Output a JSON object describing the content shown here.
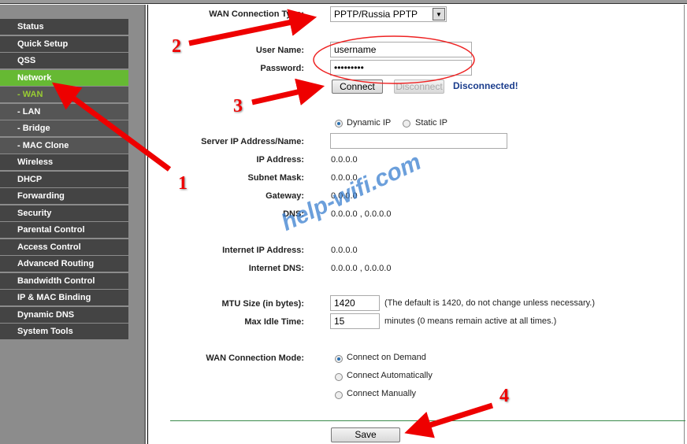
{
  "sidebar": {
    "items": [
      {
        "label": "Status"
      },
      {
        "label": "Quick Setup"
      },
      {
        "label": "QSS"
      },
      {
        "label": "Network",
        "active": true
      },
      {
        "label": "- WAN",
        "sub": true,
        "current": true
      },
      {
        "label": "- LAN",
        "sub": true
      },
      {
        "label": "- Bridge",
        "sub": true
      },
      {
        "label": "- MAC Clone",
        "sub": true
      },
      {
        "label": "Wireless"
      },
      {
        "label": "DHCP"
      },
      {
        "label": "Forwarding"
      },
      {
        "label": "Security"
      },
      {
        "label": "Parental Control"
      },
      {
        "label": "Access Control"
      },
      {
        "label": "Advanced Routing"
      },
      {
        "label": "Bandwidth Control"
      },
      {
        "label": "IP & MAC Binding"
      },
      {
        "label": "Dynamic DNS"
      },
      {
        "label": "System Tools"
      }
    ]
  },
  "form": {
    "wan_type_label": "WAN Connection Type:",
    "wan_type_value": "PPTP/Russia PPTP",
    "username_label": "User Name:",
    "username_value": "username",
    "password_label": "Password:",
    "password_value": "•••••••••",
    "connect": "Connect",
    "disconnect": "Disconnect",
    "status": "Disconnected!",
    "dynamic_ip": "Dynamic IP",
    "static_ip": "Static IP",
    "server_label": "Server IP Address/Name:",
    "server_value": "",
    "ip_label": "IP Address:",
    "ip_value": "0.0.0.0",
    "mask_label": "Subnet Mask:",
    "mask_value": "0.0.0.0",
    "gw_label": "Gateway:",
    "gw_value": "0.0.0.0",
    "dns_label": "DNS:",
    "dns_value": "0.0.0.0 , 0.0.0.0",
    "inet_ip_label": "Internet IP Address:",
    "inet_ip_value": "0.0.0.0",
    "inet_dns_label": "Internet DNS:",
    "inet_dns_value": "0.0.0.0 , 0.0.0.0",
    "mtu_label": "MTU Size (in bytes):",
    "mtu_value": "1420",
    "mtu_hint": "(The default is 1420, do not change unless necessary.)",
    "idle_label": "Max Idle Time:",
    "idle_value": "15",
    "idle_hint": "minutes (0 means remain active at all times.)",
    "mode_label": "WAN Connection Mode:",
    "mode_options": [
      "Connect on Demand",
      "Connect Automatically",
      "Connect Manually"
    ],
    "save": "Save"
  },
  "annotations": {
    "numbers": [
      "1",
      "2",
      "3",
      "4"
    ],
    "watermark": "help-wifi.com",
    "color": "#ee0000"
  }
}
